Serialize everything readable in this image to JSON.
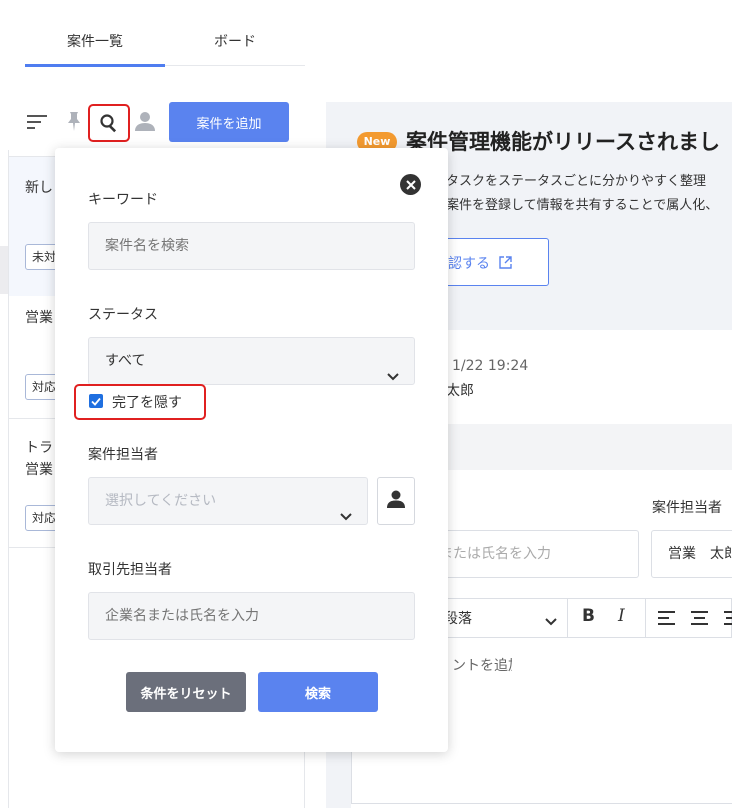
{
  "tabs": {
    "list": "案件一覧",
    "board": "ボード"
  },
  "toolbar": {
    "add_label": "案件を追加"
  },
  "list": {
    "items": [
      {
        "title": "新し",
        "badge": "未対"
      },
      {
        "title": "営業",
        "badge": "対応"
      },
      {
        "title_line1": "トラ",
        "title_line2": "営業",
        "badge": "対応"
      }
    ]
  },
  "announcement": {
    "badge": "New",
    "title": "案件管理機能がリリースされまし",
    "line1": "タスクをステータスごとに分かりやすく整理",
    "line2": "案件を登録して情報を共有することで属人化、",
    "confirm_label": "確認する"
  },
  "card": {
    "date": "1/22 19:24",
    "author": "太郎",
    "assignee_label": "案件担当者",
    "client_placeholder": "企業名または氏名を入力",
    "assignee_value": "営業　太郎",
    "paragraph_style": "段落",
    "editor_placeholder": "コメントを追加"
  },
  "search_popup": {
    "keyword_label": "キーワード",
    "keyword_placeholder": "案件名を検索",
    "status_label": "ステータス",
    "status_value": "すべて",
    "hide_completed_label": "完了を隠す",
    "hide_completed_checked": true,
    "assignee_label": "案件担当者",
    "assignee_placeholder": "選択してください",
    "client_label": "取引先担当者",
    "client_placeholder": "企業名または氏名を入力",
    "reset_label": "条件をリセット",
    "search_label": "検索"
  },
  "colors": {
    "accent": "#5a83ef",
    "new_badge": "#f39a30",
    "highlight": "#e02020",
    "checkbox": "#1f6fe0"
  }
}
